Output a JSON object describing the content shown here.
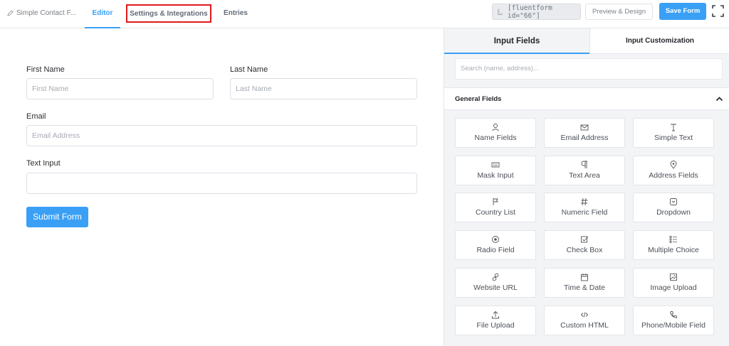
{
  "topbar": {
    "form_name": "Simple Contact F...",
    "tabs": [
      {
        "label": "Editor"
      },
      {
        "label": "Settings & Integrations"
      },
      {
        "label": "Entries"
      }
    ],
    "shortcode": "[fluentform id=\"66\"]",
    "preview_label": "Preview & Design",
    "save_label": "Save Form",
    "fullscreen_icon": "fullscreen-icon"
  },
  "form": {
    "first_name_label": "First Name",
    "first_name_placeholder": "First Name",
    "last_name_label": "Last Name",
    "last_name_placeholder": "Last Name",
    "email_label": "Email",
    "email_placeholder": "Email Address",
    "text_input_label": "Text Input",
    "text_input_placeholder": "",
    "submit_label": "Submit Form"
  },
  "panel": {
    "tabs": [
      {
        "label": "Input Fields"
      },
      {
        "label": "Input Customization"
      }
    ],
    "search_placeholder": "Search (name, address)...",
    "section_title": "General Fields",
    "fields": [
      {
        "label": "Name Fields",
        "icon": "user-icon"
      },
      {
        "label": "Email Address",
        "icon": "envelope-icon"
      },
      {
        "label": "Simple Text",
        "icon": "text-cursor-icon"
      },
      {
        "label": "Mask Input",
        "icon": "keyboard-icon"
      },
      {
        "label": "Text Area",
        "icon": "paragraph-icon"
      },
      {
        "label": "Address Fields",
        "icon": "map-pin-icon"
      },
      {
        "label": "Country List",
        "icon": "flag-icon"
      },
      {
        "label": "Numeric Field",
        "icon": "hash-icon"
      },
      {
        "label": "Dropdown",
        "icon": "dropdown-icon"
      },
      {
        "label": "Radio Field",
        "icon": "radio-icon"
      },
      {
        "label": "Check Box",
        "icon": "checkbox-icon"
      },
      {
        "label": "Multiple Choice",
        "icon": "list-icon"
      },
      {
        "label": "Website URL",
        "icon": "link-icon"
      },
      {
        "label": "Time & Date",
        "icon": "calendar-icon"
      },
      {
        "label": "Image Upload",
        "icon": "image-icon"
      },
      {
        "label": "File Upload",
        "icon": "upload-icon"
      },
      {
        "label": "Custom HTML",
        "icon": "code-icon"
      },
      {
        "label": "Phone/Mobile Field",
        "icon": "phone-icon"
      }
    ]
  },
  "colors": {
    "accent": "#3aa0f6",
    "highlight_box": "#e01a1a"
  }
}
